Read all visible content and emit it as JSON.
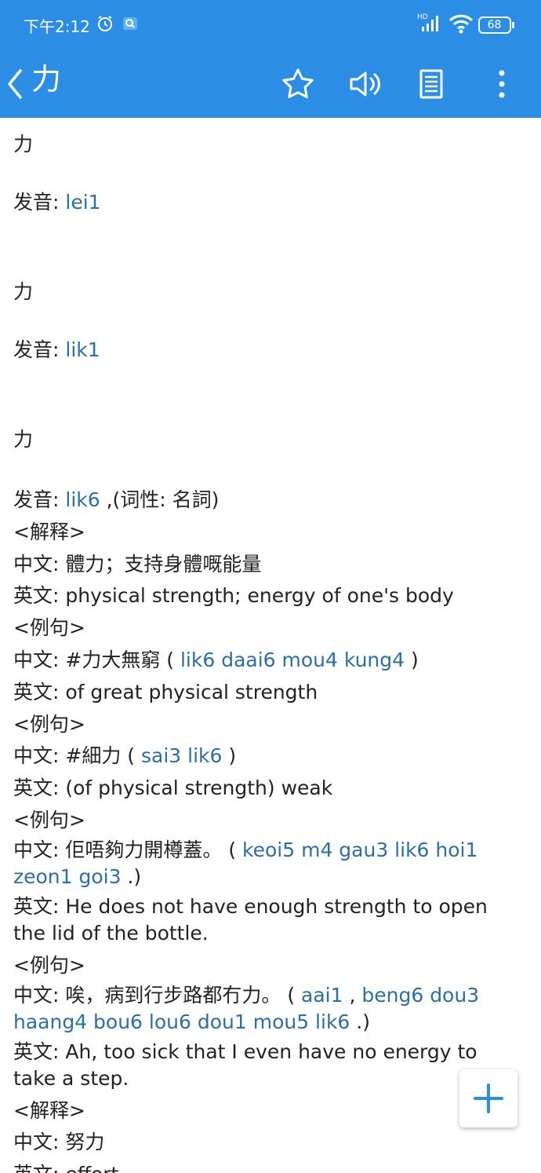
{
  "status": {
    "time": "下午2:12",
    "battery": "68",
    "network_badge": "HD"
  },
  "header": {
    "title": "力"
  },
  "content": {
    "label_pron": "发音: ",
    "label_zh": "中文: ",
    "label_en": "英文: ",
    "label_explain": "<解释>",
    "label_example": "<例句>",
    "entries": [
      {
        "char": "力",
        "pron": "lei1"
      },
      {
        "char": "力",
        "pron": "lik1"
      },
      {
        "char": "力",
        "pron": "lik6",
        "pos": " ,(词性: 名詞)"
      }
    ],
    "ex1_zh": "#力大無窮 ( ",
    "ex1_jp": "lik6 daai6 mou4 kung4",
    "ex1_end": " )",
    "ex1_en": "of great physical strength",
    "ex2_zh": "#細力 ( ",
    "ex2_jp": "sai3 lik6",
    "ex2_end": " )",
    "ex2_en": "(of physical strength) weak",
    "ex3_zh": "佢唔夠力開樽蓋。 ( ",
    "ex3_jp": "keoi5 m4 gau3 lik6 hoi1 zeon1 goi3",
    "ex3_end": " .)",
    "ex3_en": "He does not have enough strength to open the lid of the bottle.",
    "ex4_zh": "唉，病到行步路都冇力。 ( ",
    "ex4_jp1": "aai1",
    "ex4_sep": " , ",
    "ex4_jp2": "beng6 dou3 haang4 bou6 lou6 dou1 mou5 lik6",
    "ex4_end": " .)",
    "ex4_en": "Ah, too sick that I even have no energy to take a step.",
    "def1_zh": "體力；支持身體嘅能量",
    "def1_en": "physical strength; energy of one's body",
    "def2_zh": "努力",
    "def2_en": "effort"
  },
  "colors": {
    "primary": "#2b8de4",
    "link": "#2a6fa8"
  }
}
